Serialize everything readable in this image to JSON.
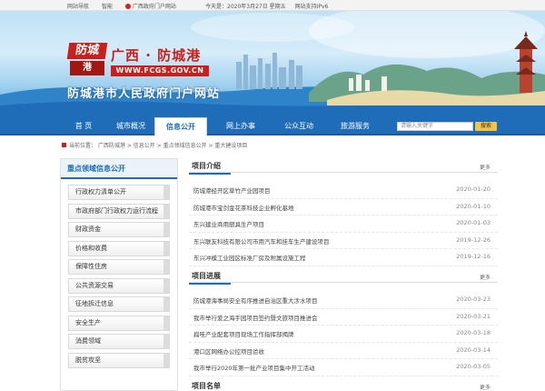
{
  "topbar": {
    "links": [
      "网站导航",
      "智能",
      "广西政府门户网站"
    ],
    "date": "今天是：2020年3月27日 星期五",
    "ipv6": "网站支持IPv6"
  },
  "banner": {
    "logo_top": "防城",
    "logo_bottom": "港",
    "title": "广西 · 防城港",
    "url": "WWW.FCGS.GOV.CN",
    "subtitle": "防城港市人民政府门户网站"
  },
  "nav": {
    "items": [
      "首 页",
      "城市概况",
      "信息公开",
      "网上办事",
      "公众互动",
      "旅游服务"
    ],
    "active_index": 2,
    "search_placeholder": "请输入关键字",
    "search_button": "搜索"
  },
  "breadcrumb": "当前位置： 广西防城港 > 信息公开 > 重点领域信息公开 > 重大建设项目",
  "sidebar": {
    "title": "重点领域信息公开",
    "items": [
      "行政权力清单公开",
      "市政府部门行政权力运行流程",
      "财政资金",
      "价格和收费",
      "保障性住房",
      "公共资源交易",
      "征地拆迁信息",
      "安全生产",
      "消费领域",
      "脱贫攻坚"
    ]
  },
  "sections": [
    {
      "title": "项目介绍",
      "more": "更多",
      "rows": [
        {
          "title": "防城港经开区草竹产业园项目",
          "date": "2020-01-20"
        },
        {
          "title": "防城港市宝剑金花茶科技企业孵化基地",
          "date": "2020-01-10"
        },
        {
          "title": "东兴建业商用厨具生产项目",
          "date": "2020-01-03"
        },
        {
          "title": "东兴联友科技有限公司市用汽车和挂车生产建设项目",
          "date": "2019-12-26"
        },
        {
          "title": "东兴冲模工业园区标准厂房及附属设施工程",
          "date": "2019-12-16"
        }
      ]
    },
    {
      "title": "项目进展",
      "more": "更多",
      "rows": [
        {
          "title": "防城港海事局安全有序推进自治区重大涉水项目",
          "date": "2020-03-23"
        },
        {
          "title": "我市举行爱之海手园项目签约暨文旅项目推进会",
          "date": "2020-03-21"
        },
        {
          "title": "扁哇产业配套项目现场工作指挥部揭牌",
          "date": "2020-03-18"
        },
        {
          "title": "港口区网络办公控项目验收",
          "date": "2020-03-14"
        },
        {
          "title": "我市举行2020年第一批产业项目集中开工活动",
          "date": "2020-03-05"
        }
      ]
    },
    {
      "title": "项目名单",
      "more": "更多",
      "rows": []
    }
  ]
}
